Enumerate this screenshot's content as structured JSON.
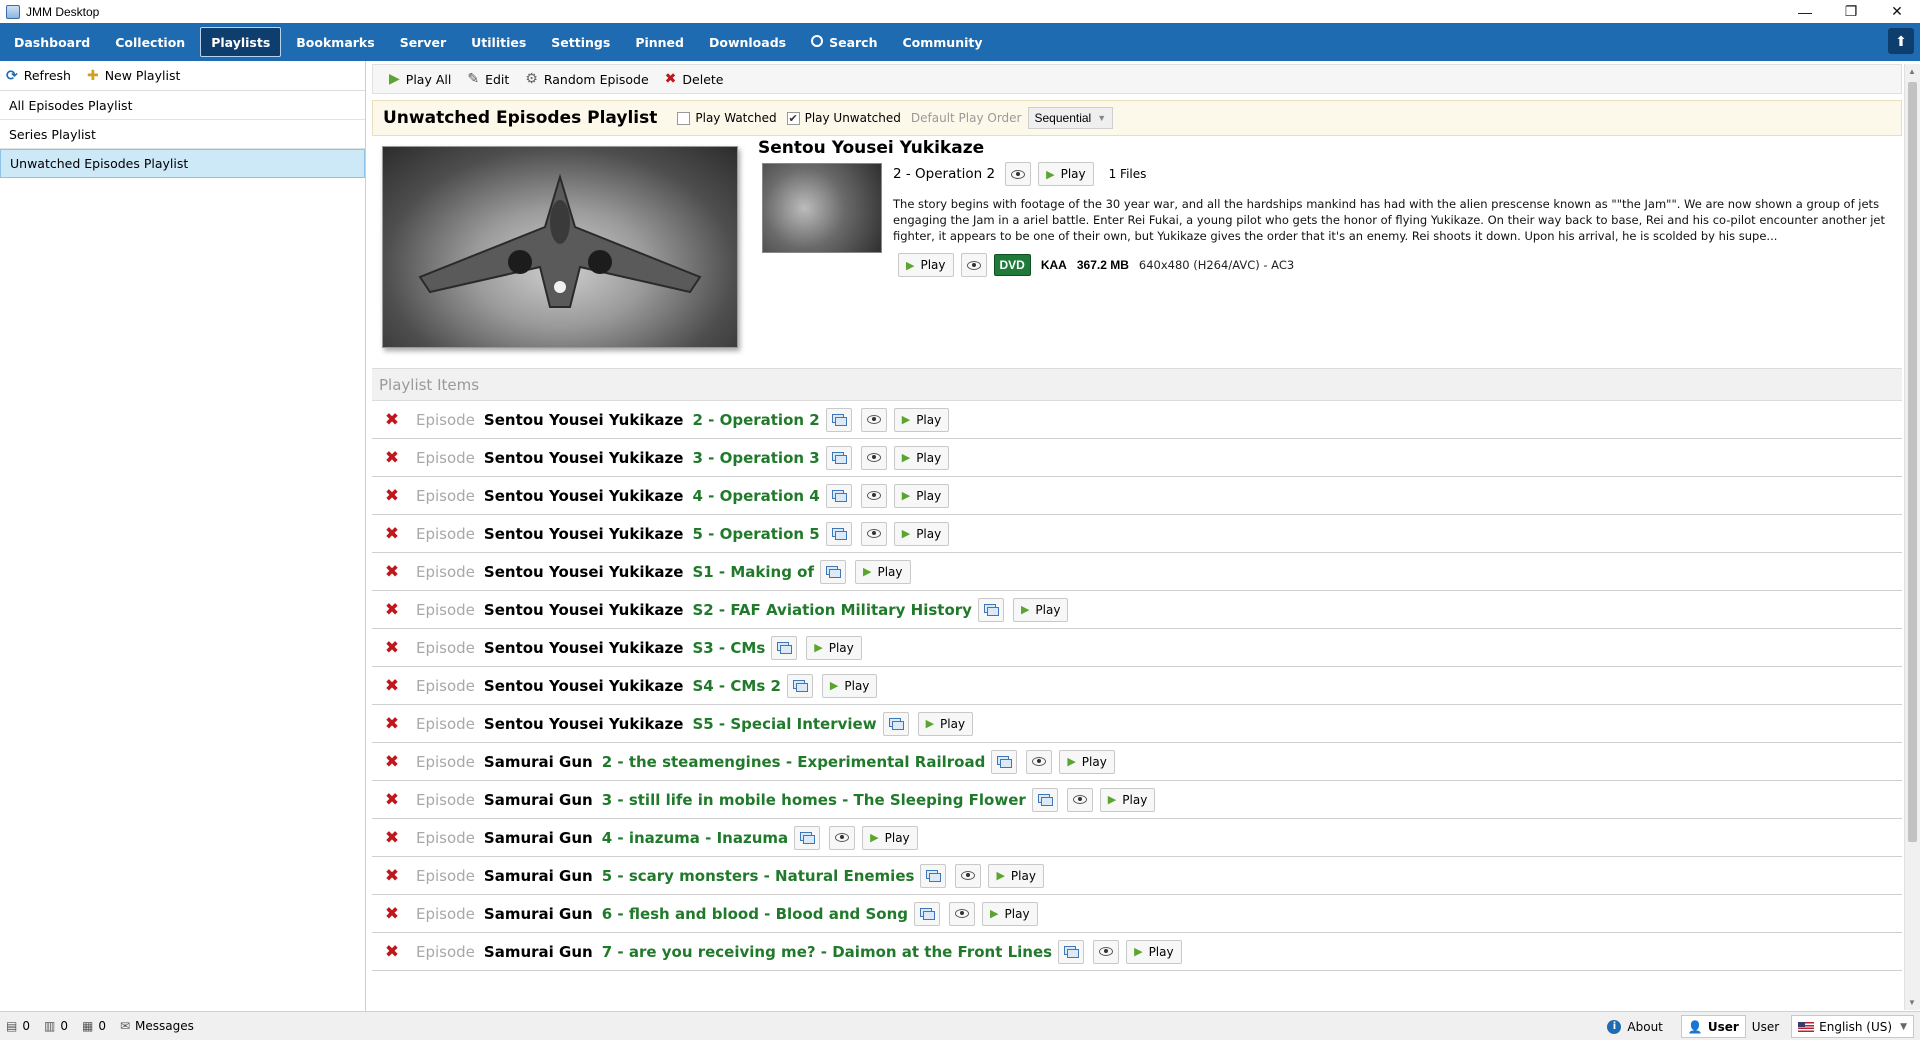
{
  "window": {
    "title": "JMM Desktop",
    "controls": {
      "minimize": "—",
      "restore": "❐",
      "close": "✕"
    }
  },
  "nav": {
    "items": [
      {
        "label": "Dashboard"
      },
      {
        "label": "Collection"
      },
      {
        "label": "Playlists",
        "active": true
      },
      {
        "label": "Bookmarks"
      },
      {
        "label": "Server"
      },
      {
        "label": "Utilities"
      },
      {
        "label": "Settings"
      },
      {
        "label": "Pinned"
      },
      {
        "label": "Downloads"
      },
      {
        "label": "Search"
      },
      {
        "label": "Community"
      }
    ],
    "corner_icon": "upload-icon"
  },
  "left": {
    "toolbar": {
      "refresh": "Refresh",
      "new_playlist": "New Playlist"
    },
    "playlists": [
      {
        "name": "All Episodes Playlist"
      },
      {
        "name": "Series Playlist"
      },
      {
        "name": "Unwatched Episodes Playlist",
        "selected": true
      }
    ]
  },
  "right": {
    "toolbar": {
      "play_all": "Play All",
      "edit": "Edit",
      "random_episode": "Random Episode",
      "delete": "Delete"
    },
    "playlist_header": {
      "title": "Unwatched Episodes Playlist",
      "play_watched": "Play Watched",
      "play_watched_checked": false,
      "play_unwatched": "Play Unwatched",
      "play_unwatched_checked": true,
      "default_play_order_label": "Default Play Order",
      "default_play_order_value": "Sequential"
    },
    "feature": {
      "series_name": "Sentou Yousei Yukikaze",
      "episode_name": "2 - Operation 2",
      "play_label": "Play",
      "files_count": "1 Files",
      "description": "The story begins with footage of the 30 year war, and all the hardships mankind has had with the alien prescense known as \"\"the Jam\"\". We are now shown a group of jets engaging the Jam in a ariel battle. Enter Rei Fukai, a young pilot who gets the honor of flying Yukikaze. On their way back to base, Rei and his co-pilot encounter another jet fighter, it appears to be one of their own, but Yukikaze gives the order that it's an enemy. Rei shoots it down. Upon his arrival, he is scolded by his supe...",
      "file": {
        "play_label": "Play",
        "source": "DVD",
        "group": "KAA",
        "size": "367.2 MB",
        "codec": "640x480 (H264/AVC) - AC3"
      }
    },
    "items_header": "Playlist Items",
    "items": [
      {
        "kind": "Episode",
        "series": "Sentou Yousei Yukikaze",
        "episode": "2 - Operation 2",
        "has_eye": true,
        "play": "Play"
      },
      {
        "kind": "Episode",
        "series": "Sentou Yousei Yukikaze",
        "episode": "3 - Operation 3",
        "has_eye": true,
        "play": "Play"
      },
      {
        "kind": "Episode",
        "series": "Sentou Yousei Yukikaze",
        "episode": "4 - Operation 4",
        "has_eye": true,
        "play": "Play"
      },
      {
        "kind": "Episode",
        "series": "Sentou Yousei Yukikaze",
        "episode": "5 - Operation 5",
        "has_eye": true,
        "play": "Play"
      },
      {
        "kind": "Episode",
        "series": "Sentou Yousei Yukikaze",
        "episode": "S1 - Making of",
        "has_eye": false,
        "play": "Play"
      },
      {
        "kind": "Episode",
        "series": "Sentou Yousei Yukikaze",
        "episode": "S2 - FAF Aviation Military History",
        "has_eye": false,
        "play": "Play"
      },
      {
        "kind": "Episode",
        "series": "Sentou Yousei Yukikaze",
        "episode": "S3 - CMs",
        "has_eye": false,
        "play": "Play"
      },
      {
        "kind": "Episode",
        "series": "Sentou Yousei Yukikaze",
        "episode": "S4 - CMs 2",
        "has_eye": false,
        "play": "Play"
      },
      {
        "kind": "Episode",
        "series": "Sentou Yousei Yukikaze",
        "episode": "S5 - Special Interview",
        "has_eye": false,
        "play": "Play"
      },
      {
        "kind": "Episode",
        "series": "Samurai Gun",
        "episode": "2 - the steamengines - Experimental Railroad",
        "has_eye": true,
        "play": "Play"
      },
      {
        "kind": "Episode",
        "series": "Samurai Gun",
        "episode": "3 - still life in mobile homes - The Sleeping Flower",
        "has_eye": true,
        "play": "Play"
      },
      {
        "kind": "Episode",
        "series": "Samurai Gun",
        "episode": "4 - inazuma - Inazuma",
        "has_eye": true,
        "play": "Play"
      },
      {
        "kind": "Episode",
        "series": "Samurai Gun",
        "episode": "5 - scary monsters - Natural Enemies",
        "has_eye": true,
        "play": "Play"
      },
      {
        "kind": "Episode",
        "series": "Samurai Gun",
        "episode": "6 - flesh and blood - Blood and Song",
        "has_eye": true,
        "play": "Play"
      },
      {
        "kind": "Episode",
        "series": "Samurai Gun",
        "episode": "7 - are you receiving me? - Daimon at the Front Lines",
        "has_eye": true,
        "play": "Play"
      }
    ]
  },
  "status": {
    "queue_hash": "0",
    "queue_general": "0",
    "queue_images": "0",
    "messages": "Messages",
    "about": "About",
    "user_button": "User",
    "user_name": "User",
    "language": "English (US)"
  },
  "colors": {
    "nav_bg": "#1f6bb1",
    "nav_active_bg": "#0d3e6e",
    "episode_green": "#217a2b",
    "delete_red": "#c0161c",
    "dvd_badge": "#1f7a3a",
    "selected_row": "#cde8f7",
    "playlist_header_bg": "#fdf9ea"
  }
}
